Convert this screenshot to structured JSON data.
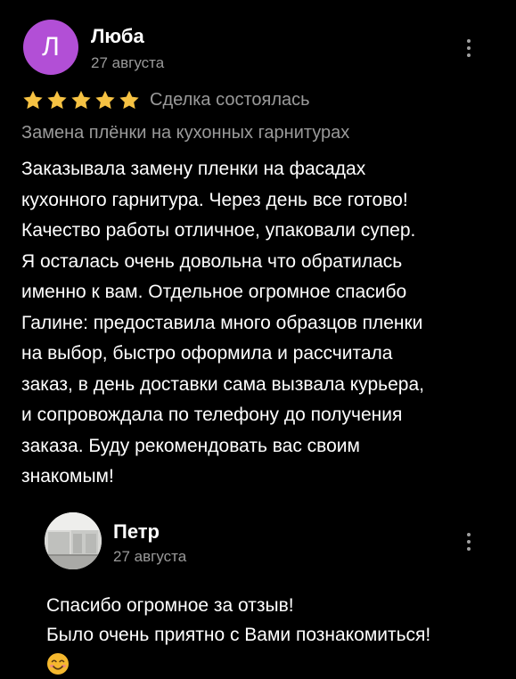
{
  "review": {
    "avatar_letter": "Л",
    "author": "Люба",
    "date": "27 августа",
    "rating": 5,
    "rating_max": 5,
    "deal_status": "Сделка состоялась",
    "service": "Замена плёнки на кухонных гарнитурах",
    "text_lines": [
      "Заказывала замену пленки на фасадах",
      "кухонного гарнитура. Через день все готово!",
      "Качество работы отличное, упаковали супер.",
      "Я осталась очень довольна что обратилась",
      "именно к вам. Отдельное огромное спасибо",
      "Галине: предоставила много образцов пленки",
      "на выбор, быстро оформила и рассчитала",
      "заказ, в день доставки сама вызвала курьера,",
      "и  сопровождала по телефону до получения",
      "заказа. Буду рекомендовать вас своим",
      "знакомым!"
    ]
  },
  "reply": {
    "author": "Петр",
    "date": "27 августа",
    "text_lines": [
      "Спасибо огромное за отзыв!",
      "Было очень приятно с Вами познакомиться!"
    ],
    "emoji": "smiling-face-emoji"
  },
  "colors": {
    "background": "#000000",
    "avatar": "#b24fd6",
    "star": "#f6c243",
    "muted_text": "#9a9a9a"
  }
}
